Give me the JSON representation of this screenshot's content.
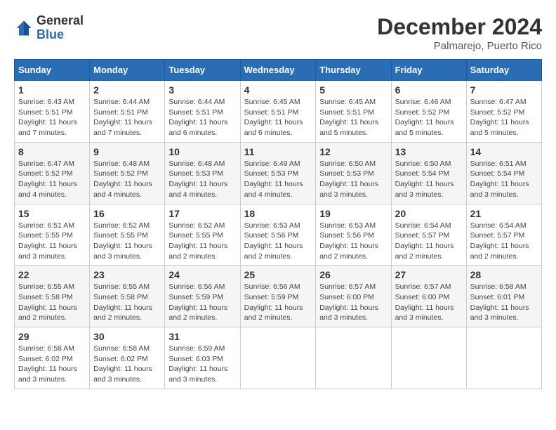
{
  "logo": {
    "general": "General",
    "blue": "Blue"
  },
  "header": {
    "month": "December 2024",
    "location": "Palmarejo, Puerto Rico"
  },
  "weekdays": [
    "Sunday",
    "Monday",
    "Tuesday",
    "Wednesday",
    "Thursday",
    "Friday",
    "Saturday"
  ],
  "weeks": [
    [
      {
        "day": "1",
        "sunrise": "6:43 AM",
        "sunset": "5:51 PM",
        "daylight": "11 hours and 7 minutes."
      },
      {
        "day": "2",
        "sunrise": "6:44 AM",
        "sunset": "5:51 PM",
        "daylight": "11 hours and 7 minutes."
      },
      {
        "day": "3",
        "sunrise": "6:44 AM",
        "sunset": "5:51 PM",
        "daylight": "11 hours and 6 minutes."
      },
      {
        "day": "4",
        "sunrise": "6:45 AM",
        "sunset": "5:51 PM",
        "daylight": "11 hours and 6 minutes."
      },
      {
        "day": "5",
        "sunrise": "6:45 AM",
        "sunset": "5:51 PM",
        "daylight": "11 hours and 5 minutes."
      },
      {
        "day": "6",
        "sunrise": "6:46 AM",
        "sunset": "5:52 PM",
        "daylight": "11 hours and 5 minutes."
      },
      {
        "day": "7",
        "sunrise": "6:47 AM",
        "sunset": "5:52 PM",
        "daylight": "11 hours and 5 minutes."
      }
    ],
    [
      {
        "day": "8",
        "sunrise": "6:47 AM",
        "sunset": "5:52 PM",
        "daylight": "11 hours and 4 minutes."
      },
      {
        "day": "9",
        "sunrise": "6:48 AM",
        "sunset": "5:52 PM",
        "daylight": "11 hours and 4 minutes."
      },
      {
        "day": "10",
        "sunrise": "6:48 AM",
        "sunset": "5:53 PM",
        "daylight": "11 hours and 4 minutes."
      },
      {
        "day": "11",
        "sunrise": "6:49 AM",
        "sunset": "5:53 PM",
        "daylight": "11 hours and 4 minutes."
      },
      {
        "day": "12",
        "sunrise": "6:50 AM",
        "sunset": "5:53 PM",
        "daylight": "11 hours and 3 minutes."
      },
      {
        "day": "13",
        "sunrise": "6:50 AM",
        "sunset": "5:54 PM",
        "daylight": "11 hours and 3 minutes."
      },
      {
        "day": "14",
        "sunrise": "6:51 AM",
        "sunset": "5:54 PM",
        "daylight": "11 hours and 3 minutes."
      }
    ],
    [
      {
        "day": "15",
        "sunrise": "6:51 AM",
        "sunset": "5:55 PM",
        "daylight": "11 hours and 3 minutes."
      },
      {
        "day": "16",
        "sunrise": "6:52 AM",
        "sunset": "5:55 PM",
        "daylight": "11 hours and 3 minutes."
      },
      {
        "day": "17",
        "sunrise": "6:52 AM",
        "sunset": "5:55 PM",
        "daylight": "11 hours and 2 minutes."
      },
      {
        "day": "18",
        "sunrise": "6:53 AM",
        "sunset": "5:56 PM",
        "daylight": "11 hours and 2 minutes."
      },
      {
        "day": "19",
        "sunrise": "6:53 AM",
        "sunset": "5:56 PM",
        "daylight": "11 hours and 2 minutes."
      },
      {
        "day": "20",
        "sunrise": "6:54 AM",
        "sunset": "5:57 PM",
        "daylight": "11 hours and 2 minutes."
      },
      {
        "day": "21",
        "sunrise": "6:54 AM",
        "sunset": "5:57 PM",
        "daylight": "11 hours and 2 minutes."
      }
    ],
    [
      {
        "day": "22",
        "sunrise": "6:55 AM",
        "sunset": "5:58 PM",
        "daylight": "11 hours and 2 minutes."
      },
      {
        "day": "23",
        "sunrise": "6:55 AM",
        "sunset": "5:58 PM",
        "daylight": "11 hours and 2 minutes."
      },
      {
        "day": "24",
        "sunrise": "6:56 AM",
        "sunset": "5:59 PM",
        "daylight": "11 hours and 2 minutes."
      },
      {
        "day": "25",
        "sunrise": "6:56 AM",
        "sunset": "5:59 PM",
        "daylight": "11 hours and 2 minutes."
      },
      {
        "day": "26",
        "sunrise": "6:57 AM",
        "sunset": "6:00 PM",
        "daylight": "11 hours and 3 minutes."
      },
      {
        "day": "27",
        "sunrise": "6:57 AM",
        "sunset": "6:00 PM",
        "daylight": "11 hours and 3 minutes."
      },
      {
        "day": "28",
        "sunrise": "6:58 AM",
        "sunset": "6:01 PM",
        "daylight": "11 hours and 3 minutes."
      }
    ],
    [
      {
        "day": "29",
        "sunrise": "6:58 AM",
        "sunset": "6:02 PM",
        "daylight": "11 hours and 3 minutes."
      },
      {
        "day": "30",
        "sunrise": "6:58 AM",
        "sunset": "6:02 PM",
        "daylight": "11 hours and 3 minutes."
      },
      {
        "day": "31",
        "sunrise": "6:59 AM",
        "sunset": "6:03 PM",
        "daylight": "11 hours and 3 minutes."
      },
      null,
      null,
      null,
      null
    ]
  ],
  "labels": {
    "sunrise": "Sunrise:",
    "sunset": "Sunset:",
    "daylight": "Daylight:"
  }
}
